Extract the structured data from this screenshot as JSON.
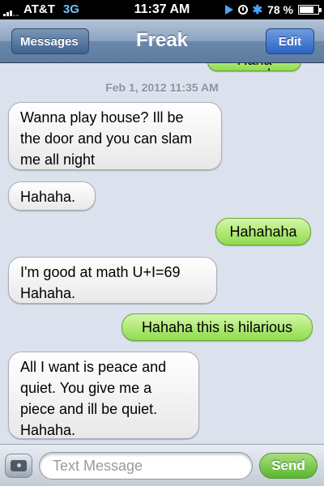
{
  "status_bar": {
    "carrier": "AT&T",
    "network": "3G",
    "time": "11:37 AM",
    "battery_percent": "78 %",
    "battery_level": 0.78,
    "icons": [
      "signal-icon",
      "play-icon",
      "location-lock-icon",
      "bluetooth-icon",
      "battery-icon"
    ]
  },
  "nav": {
    "back_label": "Messages",
    "title": "Freak",
    "edit_label": "Edit"
  },
  "conversation": {
    "partial_previous_message": "Haha good",
    "timestamp": "Feb 1, 2012 11:35 AM",
    "messages": [
      {
        "direction": "incoming",
        "lines": [
          "Wanna play house?  Ill be",
          "the door and you can slam",
          "me all night"
        ]
      },
      {
        "direction": "incoming",
        "lines": [
          "Hahaha."
        ]
      },
      {
        "direction": "outgoing",
        "lines": [
          "Hahahaha"
        ]
      },
      {
        "direction": "incoming",
        "lines": [
          "I'm good at math U+I=69",
          "Hahaha."
        ]
      },
      {
        "direction": "outgoing",
        "lines": [
          "Hahaha this is hilarious"
        ]
      },
      {
        "direction": "incoming",
        "lines": [
          "All I want is peace and",
          "quiet.  You give me a",
          "piece and ill be quiet.",
          "Hahaha."
        ]
      }
    ]
  },
  "input": {
    "placeholder": "Text Message",
    "value": "",
    "send_label": "Send"
  },
  "colors": {
    "incoming_bubble": "#ffffff",
    "outgoing_bubble": "#8fdc4e",
    "background": "#dbe2ed",
    "nav_bar": "#6b88ab"
  }
}
